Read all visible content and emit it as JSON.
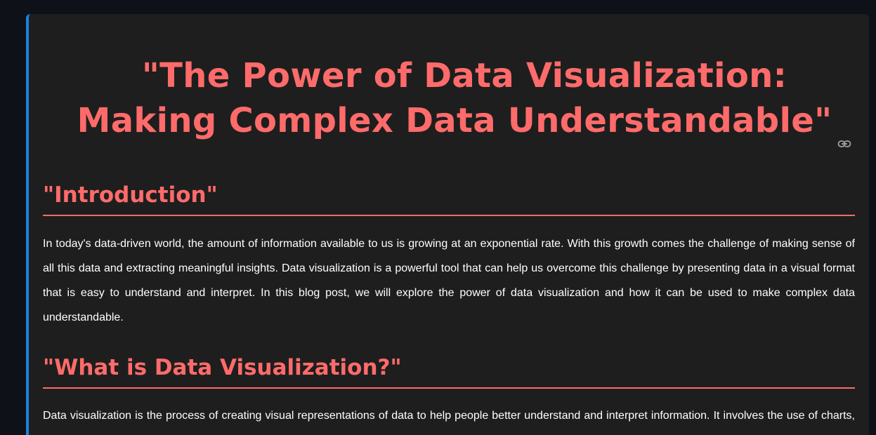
{
  "article": {
    "title": "\"The Power of Data Visualization: Making Complex Data Understandable\"",
    "sections": [
      {
        "heading": "\"Introduction\"",
        "body": "In today's data-driven world, the amount of information available to us is growing at an exponential rate. With this growth comes the challenge of making sense of all this data and extracting meaningful insights. Data visualization is a powerful tool that can help us overcome this challenge by presenting data in a visual format that is easy to understand and interpret. In this blog post, we will explore the power of data visualization and how it can be used to make complex data understandable."
      },
      {
        "heading": "\"What is Data Visualization?\"",
        "body": "Data visualization is the process of creating visual representations of data to help people better understand and interpret information. It involves the use of charts, graphs and other visual elements."
      }
    ]
  },
  "icons": {
    "title_link": "link-icon"
  },
  "colors": {
    "page_background": "#0e1117",
    "card_background": "#1e1e1e",
    "accent_border": "#1c83e1",
    "heading": "#ff6b6b",
    "body_text": "#ffffff"
  }
}
